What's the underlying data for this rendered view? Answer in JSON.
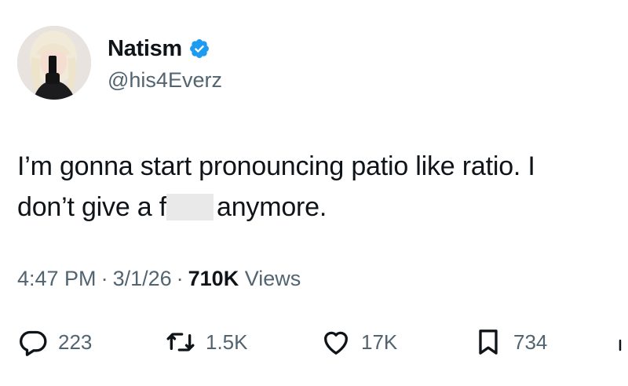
{
  "author": {
    "display_name": "Natism",
    "handle": "@his4Everz",
    "verified_icon": "verified-badge-icon",
    "avatar_icon": "avatar-photo"
  },
  "tweet": {
    "text_part1": "I’m gonna start pronouncing patio like ratio. I don’t give a f",
    "text_part2": "anymore."
  },
  "meta": {
    "time": "4:47 PM",
    "separator": "·",
    "date": "3/1/26",
    "views_count": "710K",
    "views_label": "Views"
  },
  "actions": {
    "reply": {
      "icon": "reply-icon",
      "count": "223"
    },
    "retweet": {
      "icon": "retweet-icon",
      "count": "1.5K"
    },
    "like": {
      "icon": "heart-icon",
      "count": "17K"
    },
    "bookmark": {
      "icon": "bookmark-icon",
      "count": "734"
    },
    "share": {
      "icon": "share-icon"
    }
  },
  "colors": {
    "text": "#0f1419",
    "secondary": "#536471",
    "verified": "#1d9bf0"
  }
}
